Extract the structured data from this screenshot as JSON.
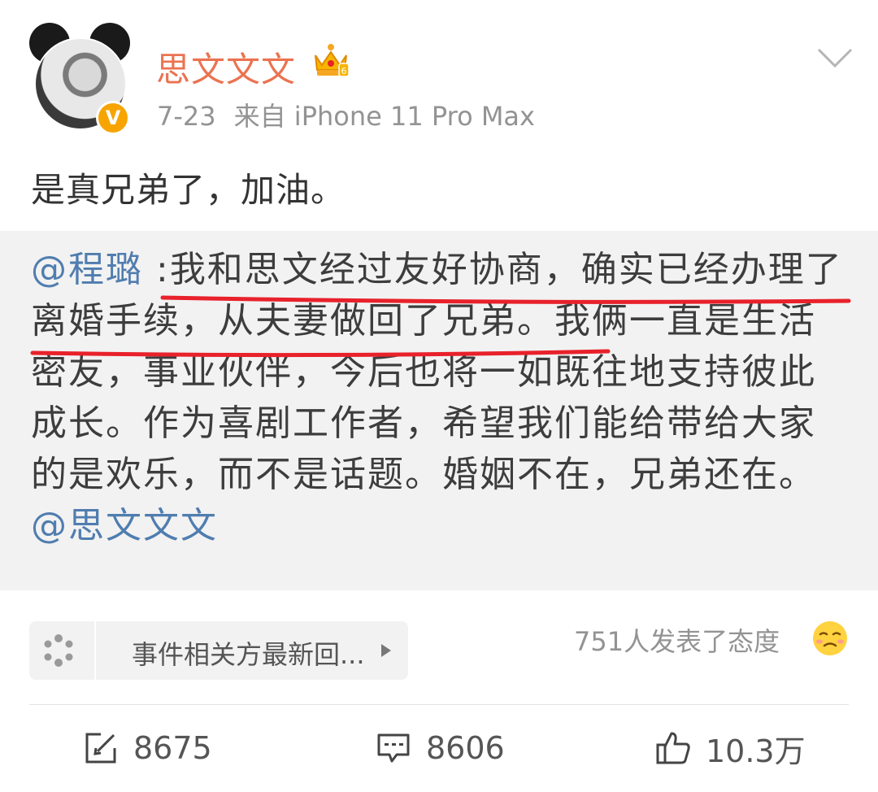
{
  "header": {
    "username": "思文文文",
    "date": "7-23",
    "source": "来自 iPhone 11 Pro Max",
    "verified_label": "V"
  },
  "post": {
    "text": "是真兄弟了，加油。"
  },
  "repost": {
    "mention": "@程璐",
    "separator": " :",
    "body": "我和思文经过友好协商，确实已经办理了离婚手续，从夫妻做回了兄弟。我俩一直是生活密友，事业伙伴，今后也将一如既往地支持彼此成长。作为喜剧工作者，希望我们能给带给大家的是欢乐，而不是话题。婚姻不在，兄弟还在。",
    "end_mention": "@思文文文"
  },
  "topic": {
    "label": "事件相关方最新回..."
  },
  "attitude": {
    "text": "751人发表了态度"
  },
  "actions": {
    "repost_count": "8675",
    "comment_count": "8606",
    "like_count": "10.3万"
  },
  "colors": {
    "username": "#eb7350",
    "mention": "#507daf",
    "underline": "#e8212b",
    "repost_bg": "#f2f2f2",
    "verified": "#f7a400"
  }
}
